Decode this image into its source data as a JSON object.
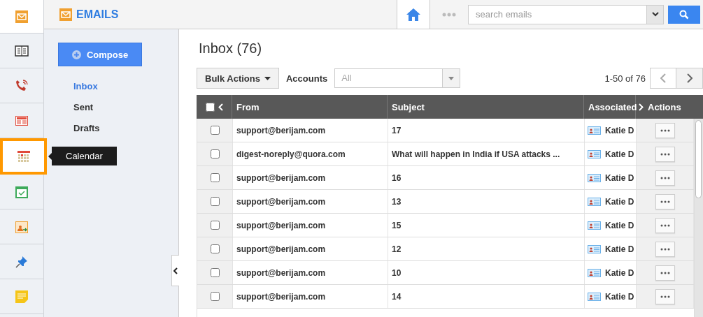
{
  "rail": {
    "items": [
      {
        "kind": "mail",
        "selected": false
      },
      {
        "kind": "book",
        "selected": false
      },
      {
        "kind": "phone",
        "selected": false
      },
      {
        "kind": "news",
        "selected": false
      },
      {
        "kind": "calendar",
        "selected": true
      },
      {
        "kind": "task",
        "selected": false
      },
      {
        "kind": "contact",
        "selected": false
      },
      {
        "kind": "pin",
        "selected": false
      },
      {
        "kind": "note",
        "selected": false
      }
    ],
    "tooltip": "Calendar"
  },
  "header": {
    "title": "EMAILS",
    "search": {
      "placeholder": "search emails"
    }
  },
  "sidebar": {
    "compose": "Compose",
    "items": [
      {
        "label": "Inbox",
        "selected": true
      },
      {
        "label": "Sent",
        "selected": false
      },
      {
        "label": "Drafts",
        "selected": false
      }
    ]
  },
  "main": {
    "title": "Inbox (76)",
    "bulk_actions": "Bulk Actions",
    "accounts_label": "Accounts",
    "accounts": {
      "value": "All"
    },
    "pagination": "1-50 of 76",
    "table": {
      "select_all": {
        "checked": false
      },
      "columns": [
        "From",
        "Subject",
        "Associated",
        "Actions"
      ],
      "rows": [
        {
          "checked": false,
          "from": "support@berijam.com",
          "subject": "17",
          "associated": "Katie D"
        },
        {
          "checked": false,
          "from": "digest-noreply@quora.com",
          "subject": "What will happen in India if USA attacks ...",
          "associated": "Katie D"
        },
        {
          "checked": false,
          "from": "support@berijam.com",
          "subject": "16",
          "associated": "Katie D"
        },
        {
          "checked": false,
          "from": "support@berijam.com",
          "subject": "13",
          "associated": "Katie D"
        },
        {
          "checked": false,
          "from": "support@berijam.com",
          "subject": "15",
          "associated": "Katie D"
        },
        {
          "checked": false,
          "from": "support@berijam.com",
          "subject": "12",
          "associated": "Katie D"
        },
        {
          "checked": false,
          "from": "support@berijam.com",
          "subject": "10",
          "associated": "Katie D"
        },
        {
          "checked": false,
          "from": "support@berijam.com",
          "subject": "14",
          "associated": "Katie D"
        }
      ]
    }
  }
}
